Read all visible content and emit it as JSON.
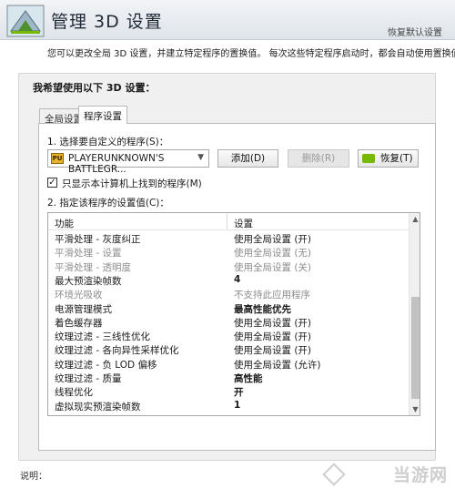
{
  "header": {
    "title": "管理 3D 设置",
    "restore_defaults": "恢复默认设置",
    "logo_icon": "nvidia-3d-settings-icon"
  },
  "intro": "您可以更改全局 3D 设置，并建立特定程序的置换值。 每次这些特定程序启动时，都会自动使用置换值。",
  "section_title": "我希望使用以下 3D 设置：",
  "tabs": [
    {
      "label": "全局设置",
      "active": false
    },
    {
      "label": "程序设置",
      "active": true
    }
  ],
  "program_settings": {
    "select_label": "1. 选择要自定义的程序(S)：",
    "selected_program": "PLAYERUNKNOWN'S BATTLEGR...",
    "add_button": "添加(D)",
    "remove_button": "删除(R)",
    "restore_button": "恢复(T)",
    "checkbox_label": "只显示本计算机上找到的程序(M)",
    "checkbox_checked": true,
    "specify_label": "2. 指定该程序的设置值(C)："
  },
  "settings_table": {
    "col_feature": "功能",
    "col_setting": "设置",
    "rows": [
      {
        "feature": "平滑处理 - 灰度纠正",
        "value": "使用全局设置 (开)",
        "dim": false,
        "bold": false
      },
      {
        "feature": "平滑处理 - 设置",
        "value": "使用全局设置 (无)",
        "dim": true,
        "bold": false
      },
      {
        "feature": "平滑处理 - 透明度",
        "value": "使用全局设置 (关)",
        "dim": true,
        "bold": false
      },
      {
        "feature": "最大预渲染帧数",
        "value": "4",
        "dim": false,
        "bold": true
      },
      {
        "feature": "环境光吸收",
        "value": "不支持此应用程序",
        "dim": true,
        "bold": false
      },
      {
        "feature": "电源管理模式",
        "value": "最高性能优先",
        "dim": false,
        "bold": true
      },
      {
        "feature": "着色缓存器",
        "value": "使用全局设置 (开)",
        "dim": false,
        "bold": false
      },
      {
        "feature": "纹理过滤 - 三线性优化",
        "value": "使用全局设置 (开)",
        "dim": false,
        "bold": false
      },
      {
        "feature": "纹理过滤 - 各向异性采样优化",
        "value": "使用全局设置 (开)",
        "dim": false,
        "bold": false
      },
      {
        "feature": "纹理过滤 - 负 LOD 偏移",
        "value": "使用全局设置 (允许)",
        "dim": false,
        "bold": false
      },
      {
        "feature": "纹理过滤 - 质量",
        "value": "高性能",
        "dim": false,
        "bold": true
      },
      {
        "feature": "线程优化",
        "value": "开",
        "dim": false,
        "bold": true
      },
      {
        "feature": "虚拟现实预渲染帧数",
        "value": "1",
        "dim": false,
        "bold": true
      }
    ]
  },
  "description_label": "说明：",
  "watermark": "当游网",
  "colors": {
    "nvidia_green": "#76b900",
    "header_bg": "#dfe4ea",
    "panel_bg": "#f0f0f0"
  }
}
